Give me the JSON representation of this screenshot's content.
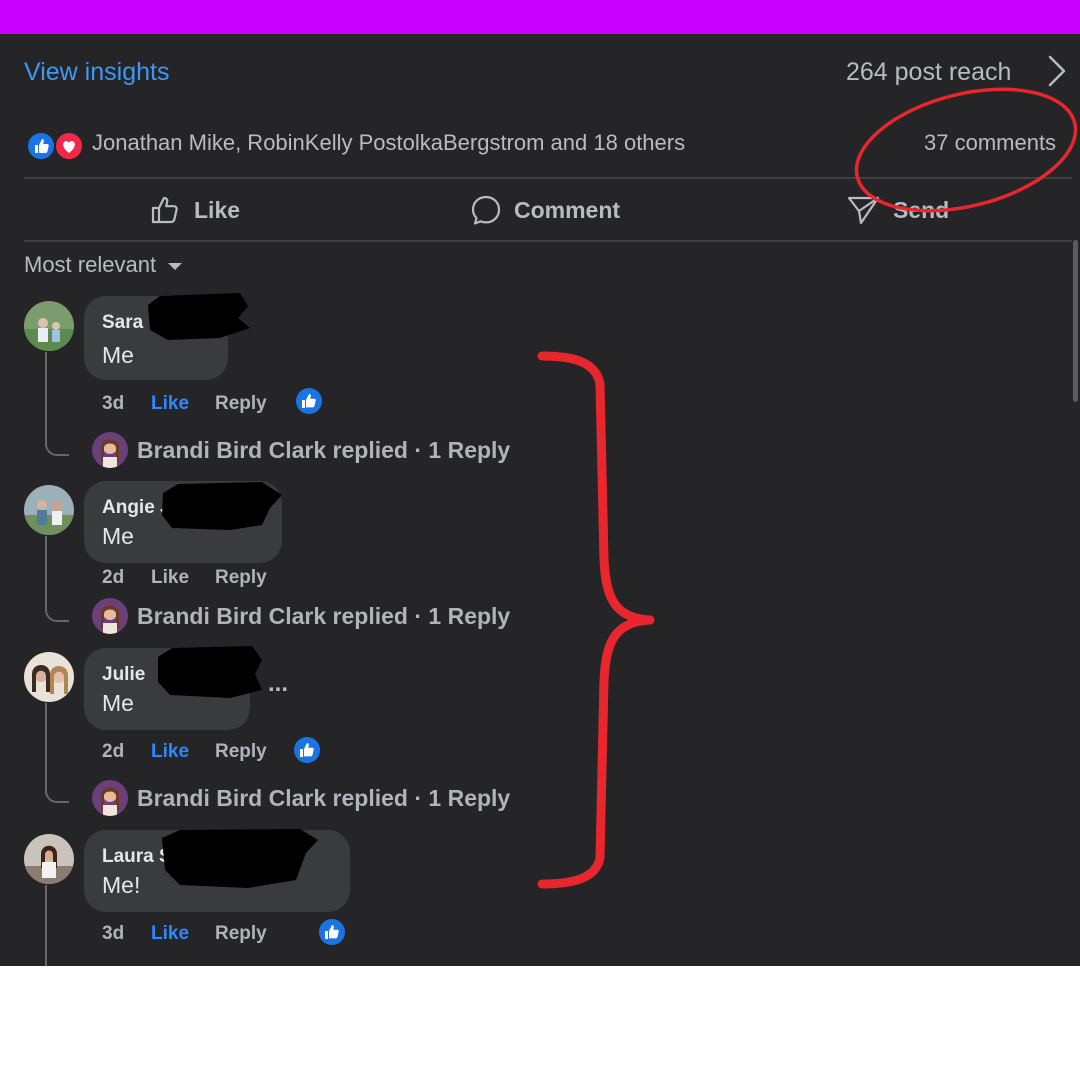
{
  "header": {
    "view_insights": "View insights",
    "post_reach": "264 post reach"
  },
  "reactions": {
    "icons": [
      "like-icon",
      "love-icon"
    ],
    "summary": "Jonathan Mike, RobinKelly PostolkaBergstrom and 18 others",
    "comment_count": "37 comments"
  },
  "actions": {
    "like": "Like",
    "comment": "Comment",
    "send": "Send"
  },
  "sort": {
    "label": "Most relevant"
  },
  "comments": [
    {
      "name": "Sara",
      "text": "Me",
      "time": "3d",
      "like": "Like",
      "reply": "Reply",
      "liked": true,
      "reply_summary": "Brandi Bird Clark replied · 1 Reply"
    },
    {
      "name": "Angie J",
      "text": "Me",
      "time": "2d",
      "like": "Like",
      "reply": "Reply",
      "liked": false,
      "reply_summary": "Brandi Bird Clark replied · 1 Reply"
    },
    {
      "name": "Julie",
      "text": "Me",
      "time": "2d",
      "like": "Like",
      "reply": "Reply",
      "liked": true,
      "more": "...",
      "reply_summary": "Brandi Bird Clark replied · 1 Reply"
    },
    {
      "name": "Laura S",
      "text": "Me!",
      "time": "3d",
      "like": "Like",
      "reply": "Reply",
      "liked": true
    }
  ],
  "colors": {
    "top_bar": "#c800ff",
    "panel_bg": "#252528",
    "link_blue": "#3d98f5",
    "like_blue": "#2d88ff",
    "annotation_red": "#e8262d"
  }
}
